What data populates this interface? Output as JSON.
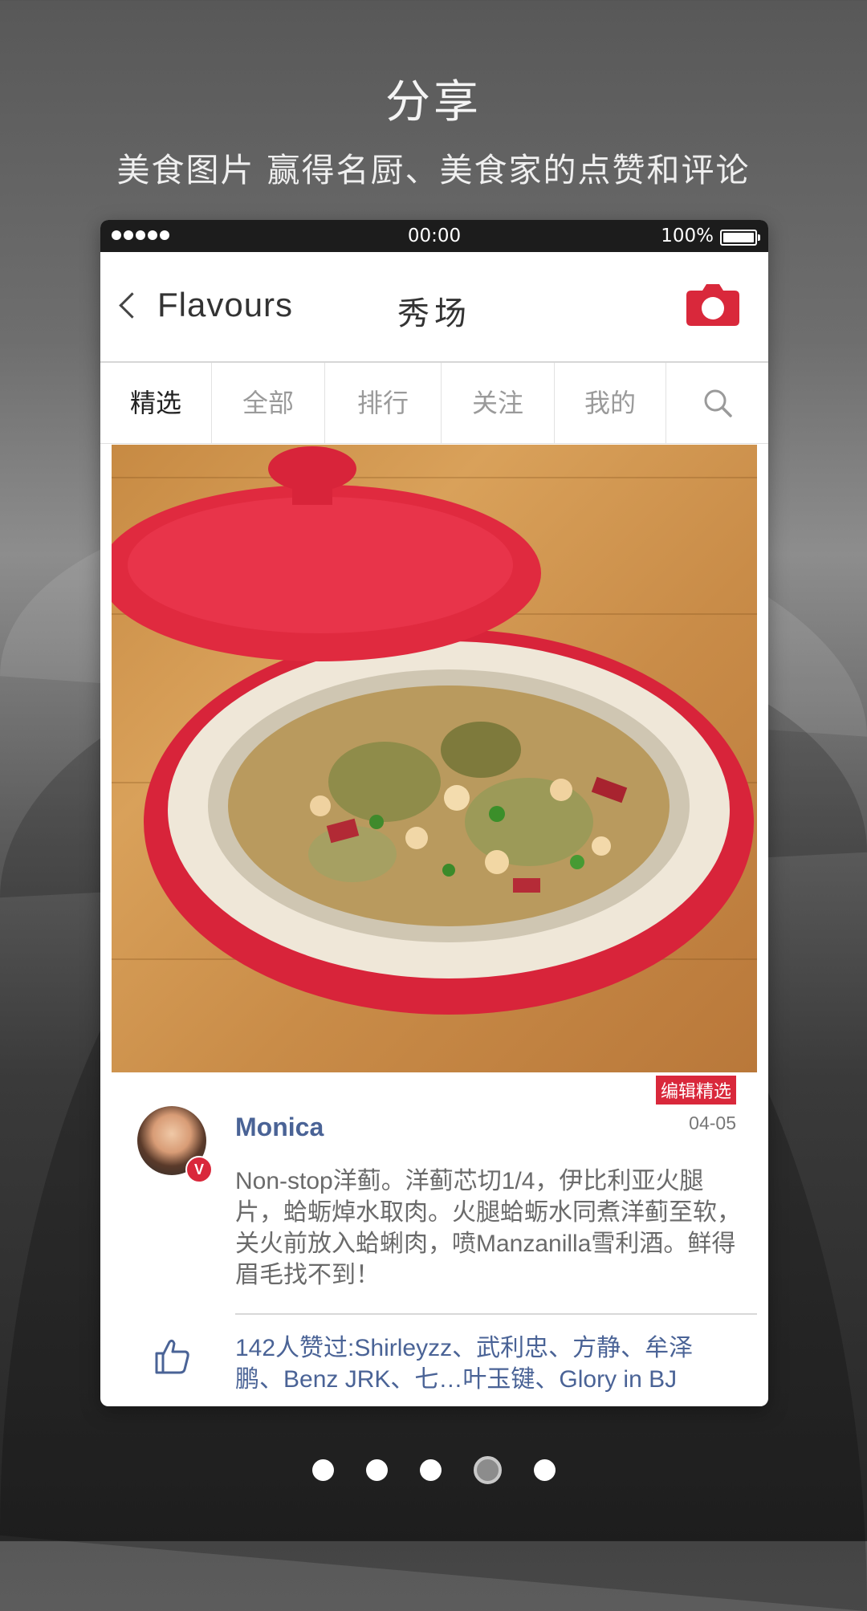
{
  "promo": {
    "title": "分享",
    "subtitle": "美食图片 赢得名厨、美食家的点赞和评论"
  },
  "status_bar": {
    "time": "00:00",
    "battery": "100%"
  },
  "nav": {
    "back_label": "Flavours",
    "title": "秀场",
    "camera_icon": "camera-icon"
  },
  "tabs": [
    {
      "label": "精选",
      "active": true
    },
    {
      "label": "全部",
      "active": false
    },
    {
      "label": "排行",
      "active": false
    },
    {
      "label": "关注",
      "active": false
    },
    {
      "label": "我的",
      "active": false
    }
  ],
  "post": {
    "badge": "编辑精选",
    "verified_mark": "V",
    "username": "Monica",
    "date": "04-05",
    "body": "Non-stop洋蓟。洋蓟芯切1/4，伊比利亚火腿片，蛤蛎焯水取肉。火腿蛤蛎水同煮洋蓟至软，关火前放入蛤蜊肉，喷Manzanilla雪利酒。鲜得眉毛找不到！",
    "likes": "142人赞过:Shirleyzz、武利忠、方静、牟泽鹏、Benz JRK、七…叶玉键、Glory in BJ"
  },
  "pager": {
    "total": 5,
    "active_index": 3
  },
  "colors": {
    "accent_red": "#d9283b",
    "link_blue": "#4a6396"
  }
}
